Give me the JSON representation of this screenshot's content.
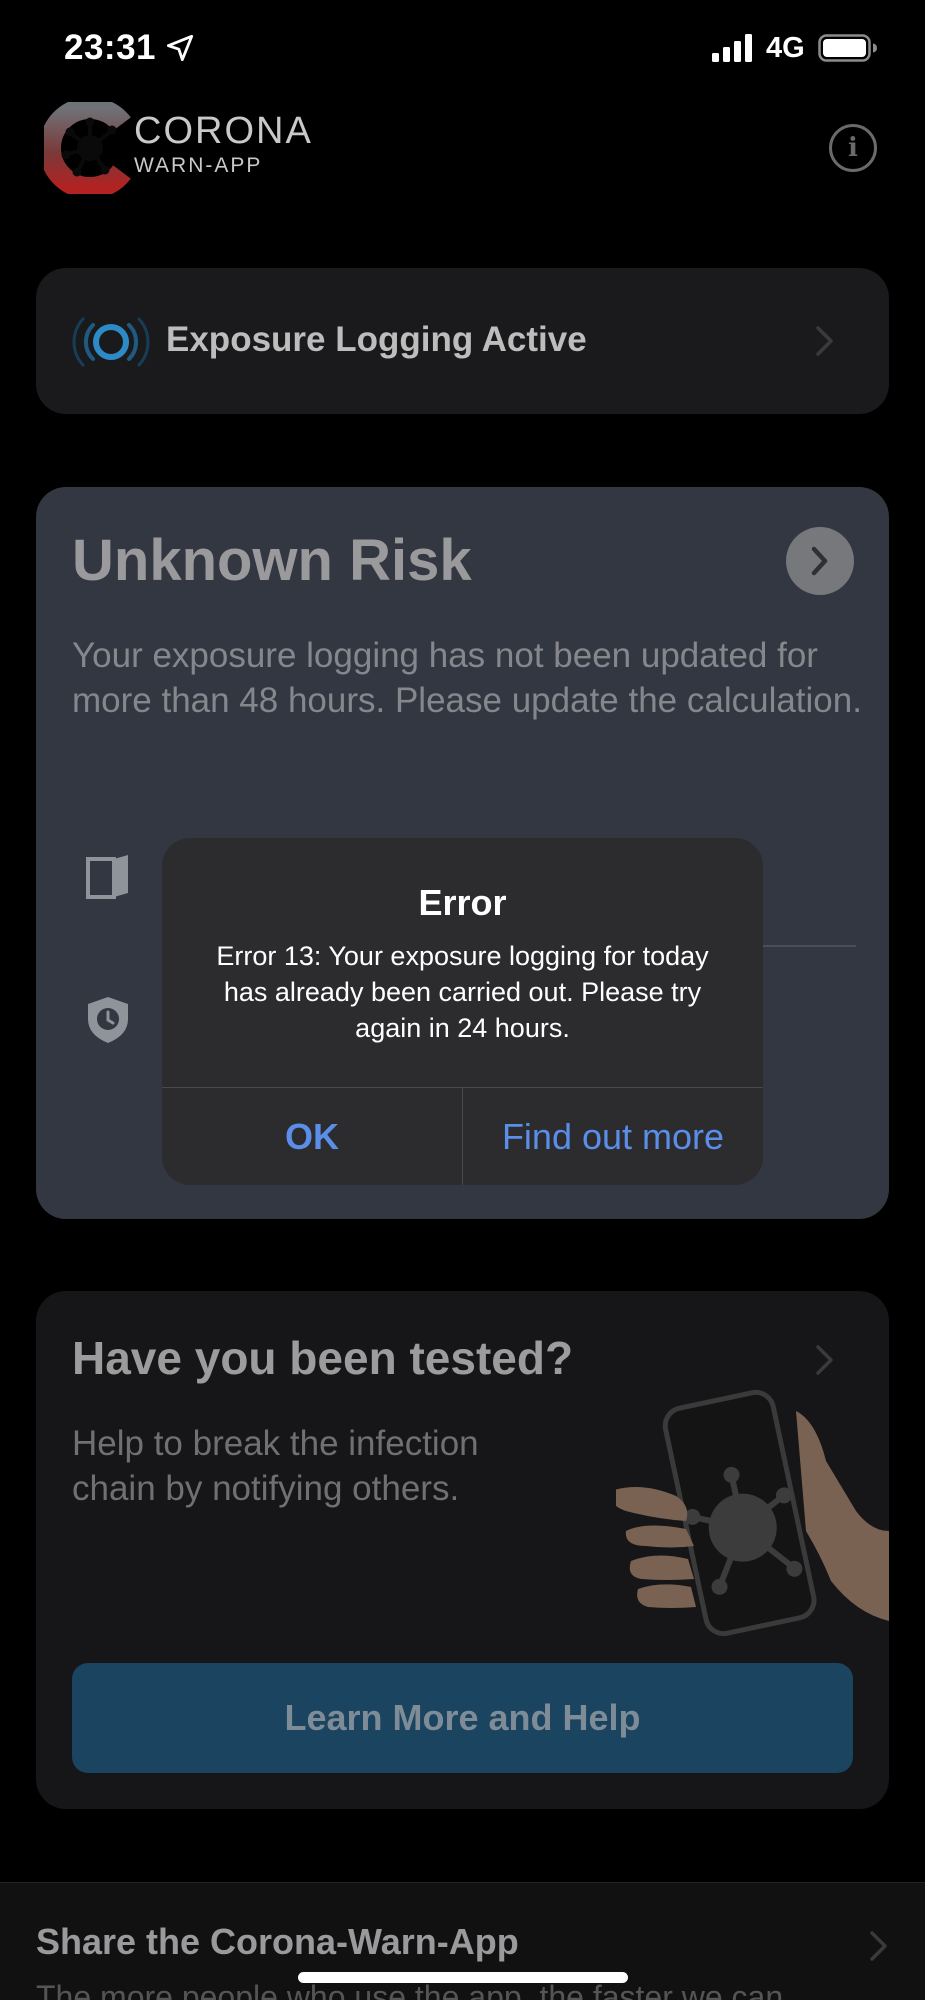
{
  "status_bar": {
    "time": "23:31",
    "network": "4G"
  },
  "header": {
    "app_name": "CORONA",
    "app_subtitle": "WARN-APP"
  },
  "exposure_card": {
    "label": "Exposure Logging Active"
  },
  "risk_card": {
    "title": "Unknown Risk",
    "description": "Your exposure logging has not been updated for more than 48 hours. Please update the calculation."
  },
  "tested_card": {
    "title": "Have you been tested?",
    "description": "Help to break the infection chain by notifying others.",
    "button_label": "Learn More and Help"
  },
  "share_section": {
    "title": "Share the Corona-Warn-App",
    "description": "The more people who use the app, the faster we can"
  },
  "dialog": {
    "title": "Error",
    "message": "Error 13: Your exposure logging for today has already been carried out. Please try again in 24 hours.",
    "ok_label": "OK",
    "more_label": "Find out more"
  },
  "colors": {
    "accent_blue": "#5b8ee9",
    "risk_card_bg": "#333742",
    "learn_button_bg": "#1a4460",
    "logo_red": "#b22222"
  }
}
